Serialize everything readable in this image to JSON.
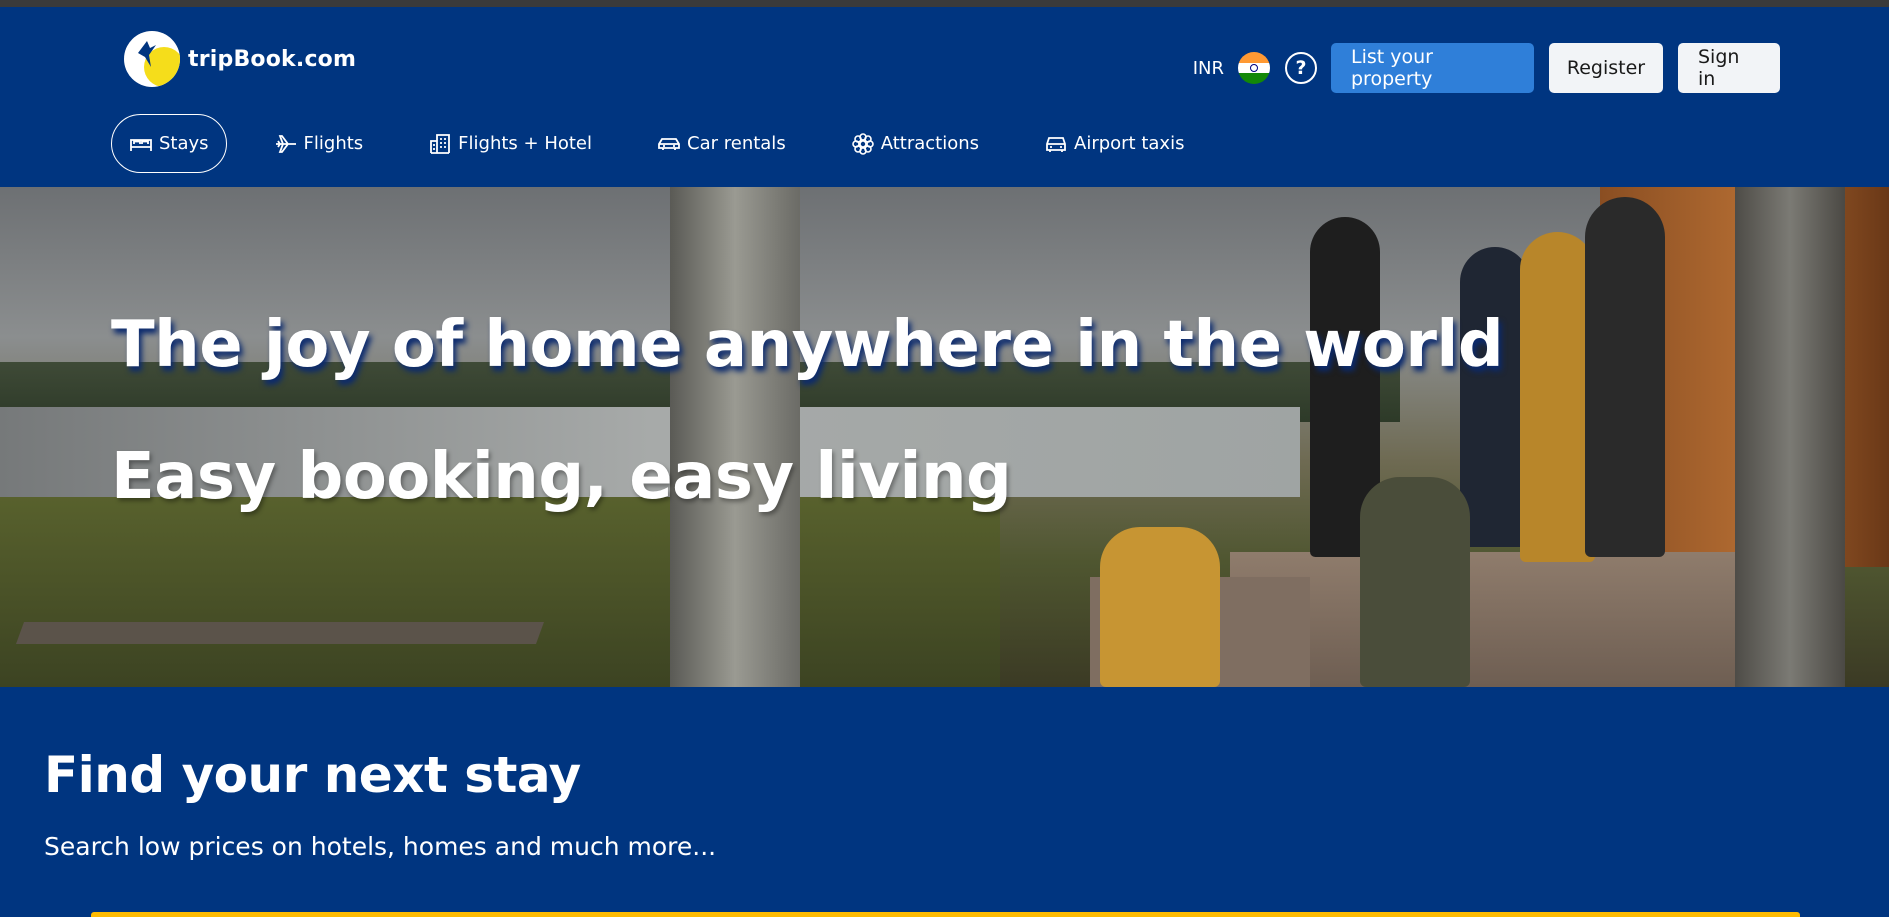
{
  "brand": {
    "name": "tripBook.com"
  },
  "header": {
    "currency": "INR",
    "help_symbol": "?",
    "list_property_label": "List your property",
    "register_label": "Register",
    "signin_label": "Sign in"
  },
  "nav": {
    "items": [
      {
        "label": "Stays",
        "icon": "bed-icon",
        "active": true
      },
      {
        "label": "Flights",
        "icon": "airplane-icon",
        "active": false
      },
      {
        "label": "Flights + Hotel",
        "icon": "hotel-building-icon",
        "active": false
      },
      {
        "label": "Car rentals",
        "icon": "car-icon",
        "active": false
      },
      {
        "label": "Attractions",
        "icon": "flower-icon",
        "active": false
      },
      {
        "label": "Airport taxis",
        "icon": "taxi-icon",
        "active": false
      }
    ]
  },
  "hero": {
    "title": "The joy of home anywhere in the world",
    "subtitle": "Easy booking, easy living"
  },
  "search": {
    "title": "Find your next stay",
    "subtitle": "Search low prices on hotels, homes and much more..."
  },
  "colors": {
    "brand_blue": "#003580",
    "accent_blue": "#2f7fd9",
    "accent_yellow": "#febb02"
  }
}
